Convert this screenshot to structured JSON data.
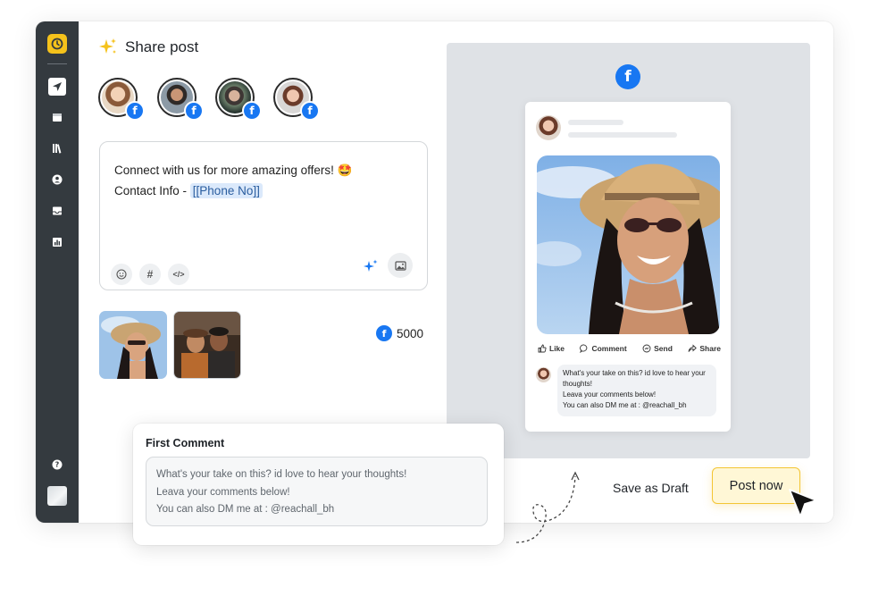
{
  "app": {
    "title": "Share post",
    "colors": {
      "accent": "#f5c21b",
      "facebook": "#1877f2",
      "sidebar": "#343a3f"
    }
  },
  "sidebar": {
    "items": [
      {
        "name": "send",
        "active": true
      },
      {
        "name": "calendar",
        "active": false
      },
      {
        "name": "library",
        "active": false
      },
      {
        "name": "account",
        "active": false
      },
      {
        "name": "inbox",
        "active": false
      },
      {
        "name": "analytics",
        "active": false
      }
    ],
    "help_icon": "help-icon"
  },
  "accounts": [
    {
      "network": "facebook",
      "badge": "f"
    },
    {
      "network": "facebook",
      "badge": "f"
    },
    {
      "network": "facebook",
      "badge": "f"
    },
    {
      "network": "facebook",
      "badge": "f"
    }
  ],
  "composer": {
    "line1": "Connect with us for more amazing offers! 🤩",
    "line2_prefix": "Contact Info - ",
    "line2_variable": "[[Phone No]]",
    "tools": {
      "hashtag": "#",
      "code": "</>"
    }
  },
  "media": {
    "likes_count": "5000"
  },
  "preview": {
    "network_badge": "f",
    "actions": {
      "like": "Like",
      "comment": "Comment",
      "send": "Send",
      "share": "Share"
    },
    "comment_lines": [
      "What's your take on this? id love to hear your thoughts!",
      "Leava your comments below!",
      "You can also DM me at : @reachall_bh"
    ]
  },
  "first_comment": {
    "title": "First Comment",
    "lines": [
      "What's your take on this? id love to hear your thoughts!",
      "Leava your comments below!",
      "You can also DM me at : @reachall_bh"
    ]
  },
  "footer": {
    "save_draft_label": "Save as Draft",
    "post_now_label": "Post now"
  }
}
